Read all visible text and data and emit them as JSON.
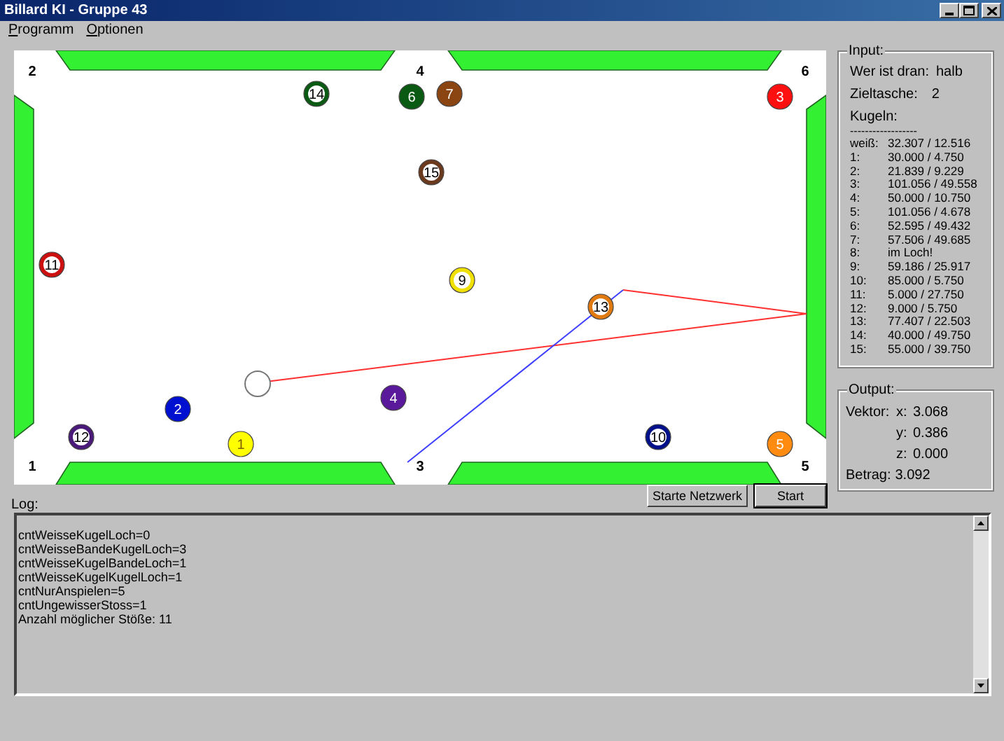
{
  "window": {
    "title": "Billard KI - Gruppe 43"
  },
  "menu": [
    {
      "mnemonic": "P",
      "rest": "rogramm"
    },
    {
      "mnemonic": "O",
      "rest": "ptionen"
    }
  ],
  "table": {
    "pockets": [
      "2",
      "4",
      "6",
      "1",
      "3",
      "5"
    ],
    "balls": [
      {
        "number": "14",
        "kind": "striped",
        "color": "#0a5a14"
      },
      {
        "number": "6",
        "kind": "solid",
        "color": "#0a5a14"
      },
      {
        "number": "7",
        "kind": "solid",
        "color": "#8b4513"
      },
      {
        "number": "3",
        "kind": "solid",
        "color": "#ff1010"
      },
      {
        "number": "15",
        "kind": "striped",
        "color": "#6b3a1e"
      },
      {
        "number": "11",
        "kind": "striped",
        "color": "#cc1010"
      },
      {
        "number": "9",
        "kind": "striped",
        "color": "#f0e000"
      },
      {
        "number": "13",
        "kind": "striped",
        "color": "#e07a10"
      },
      {
        "kind": "cue",
        "color": "#ffffff"
      },
      {
        "number": "2",
        "kind": "solid",
        "color": "#0010d0"
      },
      {
        "number": "4",
        "kind": "solid",
        "color": "#5a189a"
      },
      {
        "number": "12",
        "kind": "striped",
        "color": "#4a1a7a"
      },
      {
        "number": "1",
        "kind": "solid",
        "color": "#ffff00"
      },
      {
        "number": "10",
        "kind": "striped",
        "color": "#00108a"
      },
      {
        "number": "5",
        "kind": "solid",
        "color": "#ff8c10"
      }
    ]
  },
  "input": {
    "title": "Input:",
    "player_label": "Wer ist dran:",
    "player": "halb",
    "pocket_label": "Zieltasche:",
    "pocket": "2",
    "balls_label": "Kugeln:",
    "separator": "------------------",
    "rows": [
      {
        "label": "weiß:",
        "value": "32.307 / 12.516"
      },
      {
        "label": "1:",
        "value": "30.000 / 4.750"
      },
      {
        "label": "2:",
        "value": "21.839 / 9.229"
      },
      {
        "label": "3:",
        "value": "101.056 / 49.558"
      },
      {
        "label": "4:",
        "value": "50.000 / 10.750"
      },
      {
        "label": "5:",
        "value": "101.056 / 4.678"
      },
      {
        "label": "6:",
        "value": "52.595 / 49.432"
      },
      {
        "label": "7:",
        "value": "57.506 / 49.685"
      },
      {
        "label": "8:",
        "value": "im Loch!"
      },
      {
        "label": "9:",
        "value": "59.186 / 25.917"
      },
      {
        "label": "10:",
        "value": "85.000 / 5.750"
      },
      {
        "label": "11:",
        "value": "5.000 / 27.750"
      },
      {
        "label": "12:",
        "value": "9.000 / 5.750"
      },
      {
        "label": "13:",
        "value": "77.407 / 22.503"
      },
      {
        "label": "14:",
        "value": "40.000 / 49.750"
      },
      {
        "label": "15:",
        "value": "55.000 / 39.750"
      }
    ]
  },
  "output": {
    "title": "Output:",
    "vector_label": "Vektor:",
    "components": [
      {
        "label": "x:",
        "value": "3.068"
      },
      {
        "label": "y:",
        "value": "0.386"
      },
      {
        "label": "z:",
        "value": "0.000"
      }
    ],
    "magnitude_label": "Betrag:",
    "magnitude": "3.092"
  },
  "buttons": [
    {
      "label": "Starte Netzwerk",
      "selected": false
    },
    {
      "label": "Start",
      "selected": true
    }
  ],
  "log": {
    "label": "Log:",
    "lines": [
      "cntWeisseKugelLoch=0",
      "cntWeisseBandeKugelLoch=3",
      "cntWeisseKugelBandeLoch=1",
      "cntWeisseKugelKugelLoch=1",
      "cntNurAnspielen=5",
      "cntUngewisserStoss=1",
      "Anzahl möglicher Stöße: 11"
    ]
  }
}
